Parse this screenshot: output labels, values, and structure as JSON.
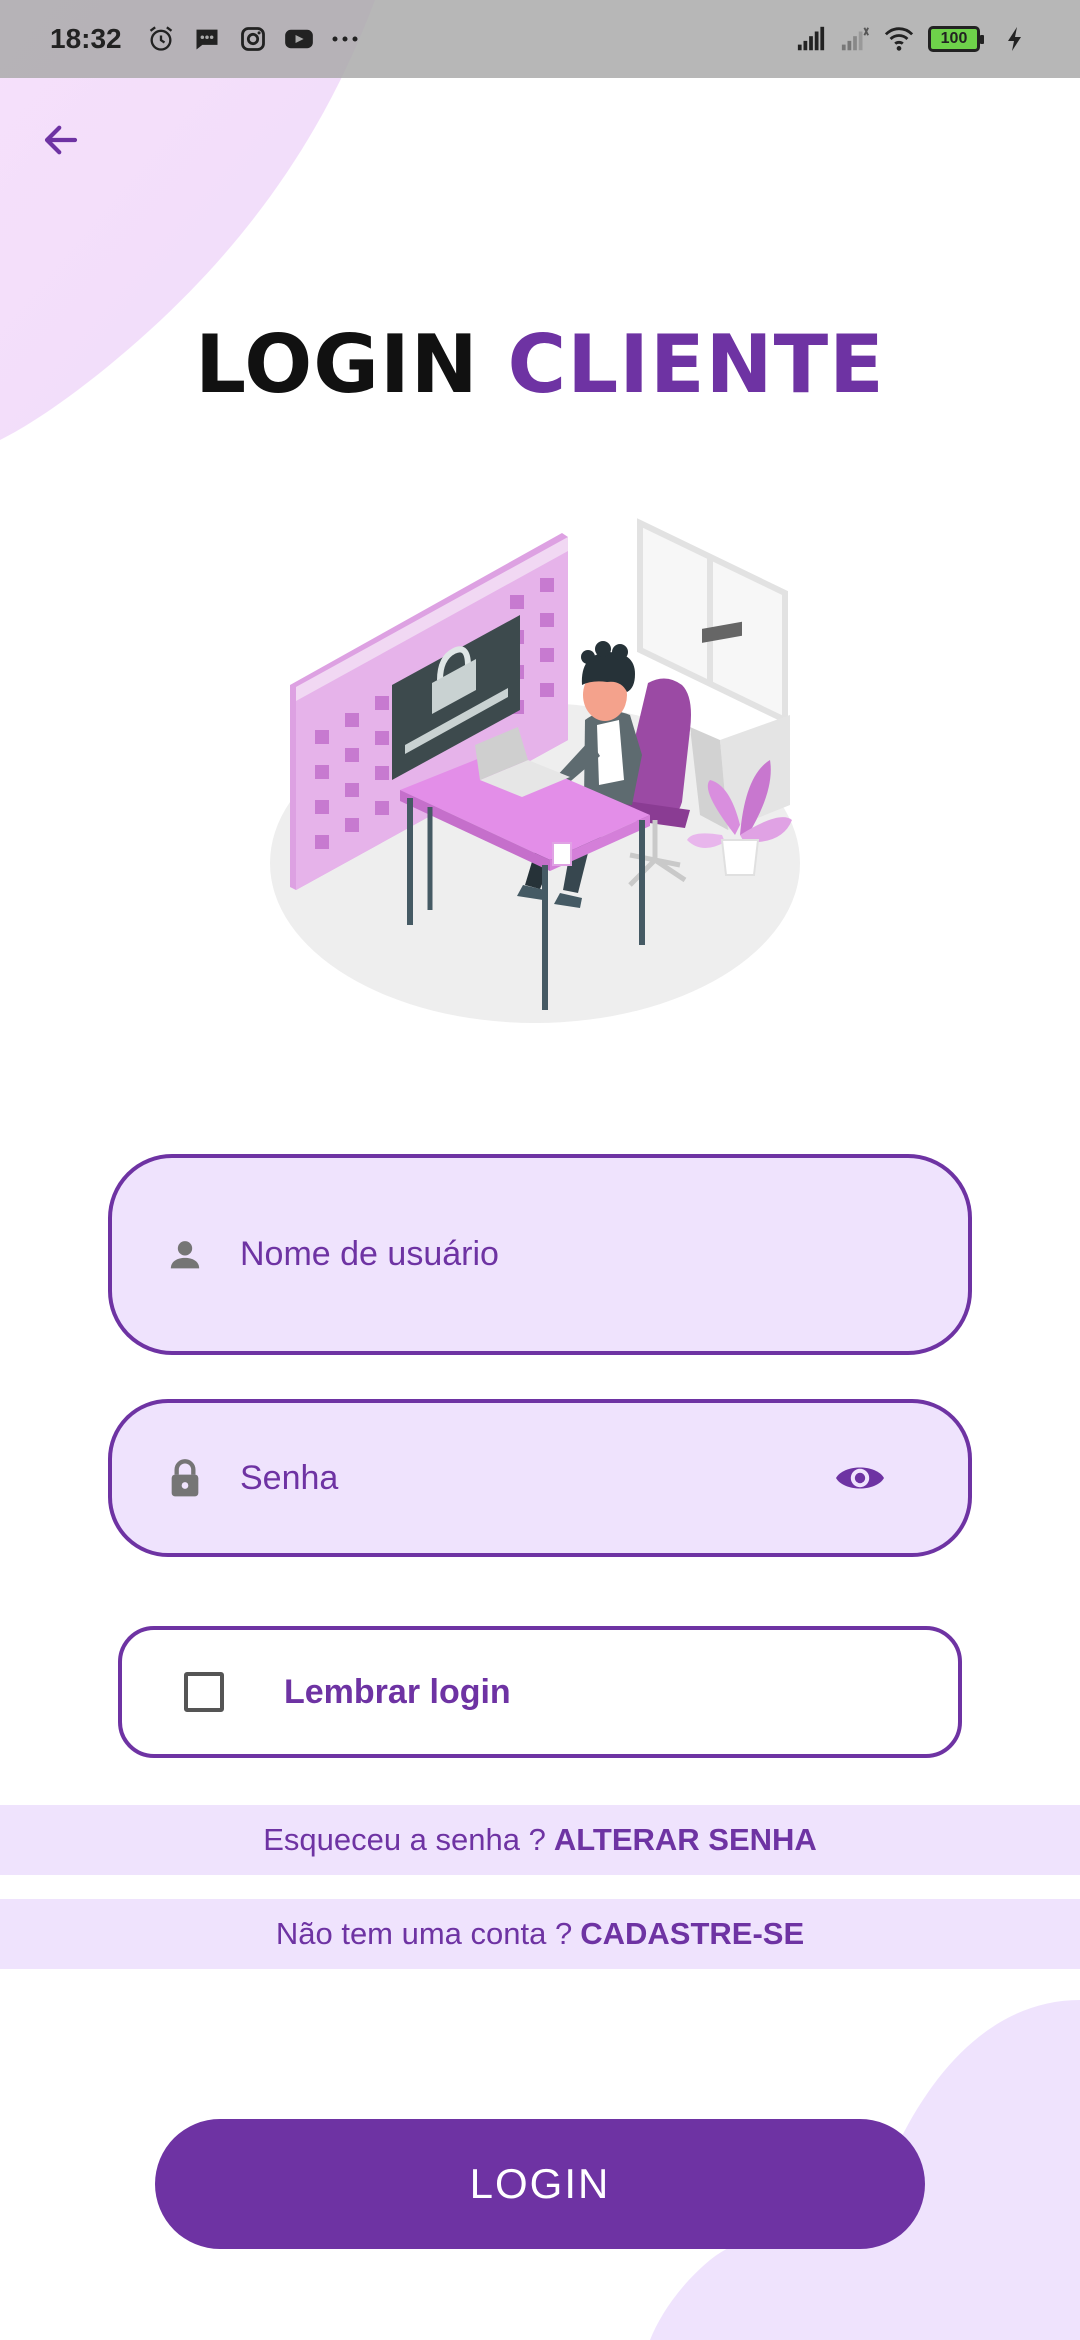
{
  "status_bar": {
    "time": "18:32",
    "battery": "100",
    "left_icons": [
      "alarm-icon",
      "message-icon",
      "instagram-icon",
      "youtube-icon",
      "more-icon"
    ],
    "right_icons": [
      "signal-icon",
      "signal-2-icon",
      "wifi-icon",
      "battery-icon",
      "charging-icon"
    ]
  },
  "header": {
    "back_icon": "arrow-left-icon",
    "title_part1": "LOGIN",
    "title_part2": "CLIENTE"
  },
  "form": {
    "username_placeholder": "Nome de usuário",
    "password_placeholder": "Senha",
    "remember_label": "Lembrar login",
    "remember_checked": false
  },
  "links": {
    "forgot_question": "Esqueceu a senha ?",
    "forgot_action": "ALTERAR SENHA",
    "signup_question": "Não tem uma conta ?",
    "signup_action": "CADASTRE-SE"
  },
  "login_button": "LOGIN",
  "colors": {
    "accent": "#6e33a3",
    "field_bg": "#efe3fd"
  }
}
